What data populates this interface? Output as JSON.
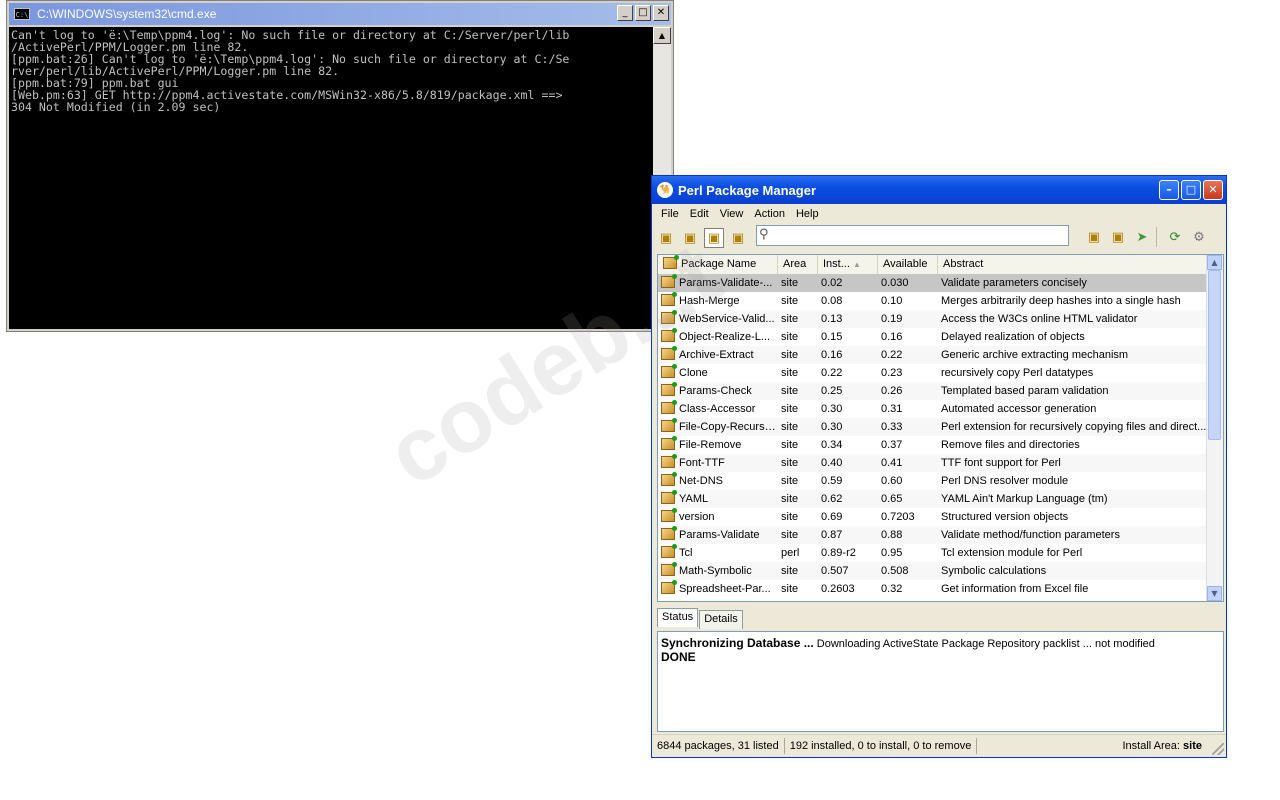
{
  "cmd": {
    "title": "C:\\WINDOWS\\system32\\cmd.exe",
    "icon": "C:\\",
    "buttons": {
      "minimize": "_",
      "maximize": "□",
      "close": "✕"
    },
    "output": "Can't log to 'ë:\\Temp\\ppm4.log': No such file or directory at C:/Server/perl/lib\n/ActivePerl/PPM/Logger.pm line 82.\n[ppm.bat:26] Can't log to 'ë:\\Temp\\ppm4.log': No such file or directory at C:/Se\nrver/perl/lib/ActivePerl/PPM/Logger.pm line 82.\n[ppm.bat:79] ppm.bat gui\n[Web.pm:63] GET http://ppm4.activestate.com/MSWin32-x86/5.8/819/package.xml ==>\n304 Not Modified (in 2.09 sec)"
  },
  "ppm": {
    "title": "Perl Package Manager",
    "menu": [
      "File",
      "Edit",
      "View",
      "Action",
      "Help"
    ],
    "search": {
      "value": "",
      "placeholder": ""
    },
    "columns": [
      "Package Name",
      "Area",
      "Inst...",
      "Available",
      "Abstract"
    ],
    "rows": [
      {
        "name": "Params-Validate-...",
        "area": "site",
        "inst": "0.02",
        "avail": "0.030",
        "abstract": "Validate parameters concisely",
        "selected": true
      },
      {
        "name": "Hash-Merge",
        "area": "site",
        "inst": "0.08",
        "avail": "0.10",
        "abstract": "Merges arbitrarily deep hashes into a single hash"
      },
      {
        "name": "WebService-Valid...",
        "area": "site",
        "inst": "0.13",
        "avail": "0.19",
        "abstract": "Access the W3Cs online HTML validator"
      },
      {
        "name": "Object-Realize-L...",
        "area": "site",
        "inst": "0.15",
        "avail": "0.16",
        "abstract": "Delayed realization of objects"
      },
      {
        "name": "Archive-Extract",
        "area": "site",
        "inst": "0.16",
        "avail": "0.22",
        "abstract": "Generic archive extracting mechanism"
      },
      {
        "name": "Clone",
        "area": "site",
        "inst": "0.22",
        "avail": "0.23",
        "abstract": "recursively copy Perl datatypes"
      },
      {
        "name": "Params-Check",
        "area": "site",
        "inst": "0.25",
        "avail": "0.26",
        "abstract": "Templated based param validation"
      },
      {
        "name": "Class-Accessor",
        "area": "site",
        "inst": "0.30",
        "avail": "0.31",
        "abstract": "Automated accessor generation"
      },
      {
        "name": "File-Copy-Recursive",
        "area": "site",
        "inst": "0.30",
        "avail": "0.33",
        "abstract": "Perl extension for recursively copying files and direct..."
      },
      {
        "name": "File-Remove",
        "area": "site",
        "inst": "0.34",
        "avail": "0.37",
        "abstract": "Remove files and directories"
      },
      {
        "name": "Font-TTF",
        "area": "site",
        "inst": "0.40",
        "avail": "0.41",
        "abstract": "TTF font support for Perl"
      },
      {
        "name": "Net-DNS",
        "area": "site",
        "inst": "0.59",
        "avail": "0.60",
        "abstract": "Perl DNS resolver module"
      },
      {
        "name": "YAML",
        "area": "site",
        "inst": "0.62",
        "avail": "0.65",
        "abstract": "YAML Ain't Markup Language (tm)"
      },
      {
        "name": "version",
        "area": "site",
        "inst": "0.69",
        "avail": "0.7203",
        "abstract": "Structured version objects"
      },
      {
        "name": "Params-Validate",
        "area": "site",
        "inst": "0.87",
        "avail": "0.88",
        "abstract": "Validate method/function parameters"
      },
      {
        "name": "Tcl",
        "area": "perl",
        "inst": "0.89-r2",
        "avail": "0.95",
        "abstract": "Tcl extension module for Perl"
      },
      {
        "name": "Math-Symbolic",
        "area": "site",
        "inst": "0.507",
        "avail": "0.508",
        "abstract": "Symbolic calculations"
      },
      {
        "name": "Spreadsheet-Par...",
        "area": "site",
        "inst": "0.2603",
        "avail": "0.32",
        "abstract": "Get information from Excel file"
      }
    ],
    "tabs": [
      "Status",
      "Details"
    ],
    "status": {
      "bold": "Synchronizing Database ...",
      "message": " Downloading ActiveState Package Repository packlist ... not modified",
      "done": "DONE"
    },
    "statusbar": {
      "packages": "6844 packages, 31 listed",
      "installed": "192 installed, 0 to install, 0 to remove",
      "install_area_label": "Install Area:",
      "install_area_value": "site"
    }
  },
  "watermark": "codeb...t"
}
